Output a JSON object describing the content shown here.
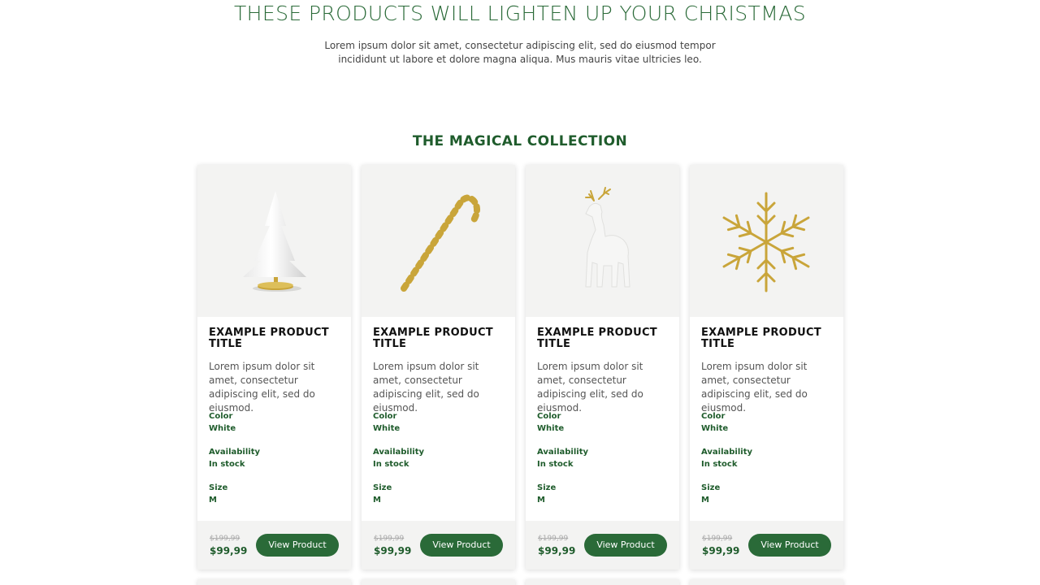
{
  "hero": {
    "title": "THESE PRODUCTS WILL LIGHTEN UP YOUR CHRISTMAS",
    "text": "Lorem ipsum dolor sit amet, consectetur adipiscing elit, sed do eiusmod tempor incididunt ut labore et dolore magna aliqua. Mus mauris vitae ultricies leo."
  },
  "collection": {
    "title": "THE MAGICAL COLLECTION",
    "products": [
      {
        "image": "white-christmas-tree-ornament",
        "title": "EXAMPLE PRODUCT TITLE",
        "description": "Lorem ipsum dolor sit amet, consectetur adipiscing elit, sed do eiusmod.",
        "color_label": "Color",
        "color_value": "White",
        "availability_label": "Availability",
        "availability_value": "In stock",
        "size_label": "Size",
        "size_value": "M",
        "old_price": "$199,99",
        "price": "$99,99",
        "button_label": "View Product"
      },
      {
        "image": "gold-candy-cane-ornament",
        "title": "EXAMPLE PRODUCT TITLE",
        "description": "Lorem ipsum dolor sit amet, consectetur adipiscing elit, sed do eiusmod.",
        "color_label": "Color",
        "color_value": "White",
        "availability_label": "Availability",
        "availability_value": "In stock",
        "size_label": "Size",
        "size_value": "M",
        "old_price": "$199,99",
        "price": "$99,99",
        "button_label": "View Product"
      },
      {
        "image": "white-reindeer-ornament",
        "title": "EXAMPLE PRODUCT TITLE",
        "description": "Lorem ipsum dolor sit amet, consectetur adipiscing elit, sed do eiusmod.",
        "color_label": "Color",
        "color_value": "White",
        "availability_label": "Availability",
        "availability_value": "In stock",
        "size_label": "Size",
        "size_value": "M",
        "old_price": "$199,99",
        "price": "$99,99",
        "button_label": "View Product"
      },
      {
        "image": "gold-snowflake-ornament",
        "title": "EXAMPLE PRODUCT TITLE",
        "description": "Lorem ipsum dolor sit amet, consectetur adipiscing elit, sed do eiusmod.",
        "color_label": "Color",
        "color_value": "White",
        "availability_label": "Availability",
        "availability_value": "In stock",
        "size_label": "Size",
        "size_value": "M",
        "old_price": "$199,99",
        "price": "$99,99",
        "button_label": "View Product"
      }
    ]
  },
  "colors": {
    "brand_green": "#2a6a38",
    "dark_green": "#1f5c2c",
    "image_bg": "#f3f3f2",
    "gold": "#c9a53a"
  }
}
